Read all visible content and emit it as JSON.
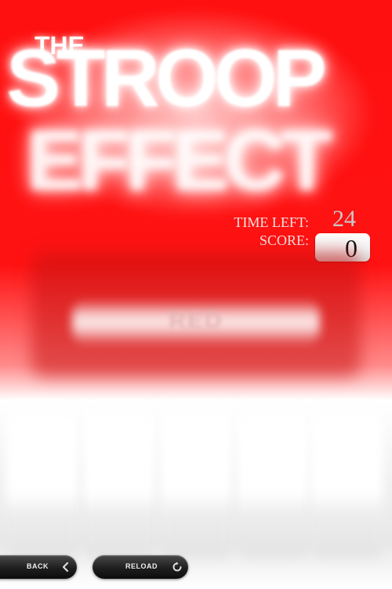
{
  "title": {
    "the": "THE",
    "stroop": "STROOP",
    "effect": "EFFECT"
  },
  "hud": {
    "time_label": "TIME LEFT:",
    "time_value": "24",
    "score_label": "SCORE:",
    "score_value": "0"
  },
  "stimulus": {
    "word": "RED"
  },
  "choices": [
    {
      "color": "#ffffff"
    },
    {
      "color": "#ffffff"
    },
    {
      "color": "#ffffff"
    },
    {
      "color": "#ffffff"
    },
    {
      "color": "#ffffff"
    }
  ],
  "buttons": {
    "back_label": "BACK",
    "back_icon": "chevron-left-icon",
    "reload_label": "RELOAD",
    "reload_icon": "reload-icon"
  },
  "colors": {
    "background_red": "#ff1010",
    "button_dark": "#1e1e1e"
  }
}
